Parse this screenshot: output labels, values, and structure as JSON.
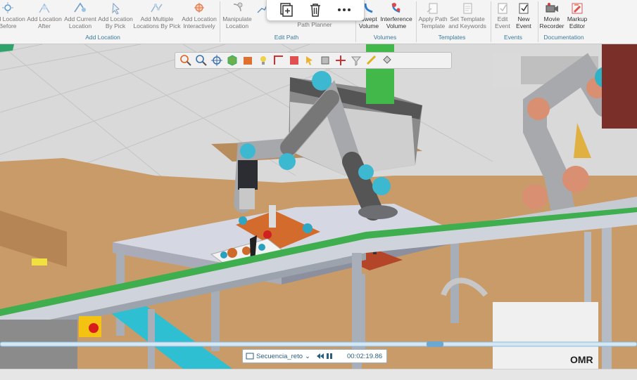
{
  "ribbon": {
    "buttons": [
      {
        "id": "add-location-before",
        "label": "Add Location\nBefore"
      },
      {
        "id": "add-location-after",
        "label": "Add Location\nAfter"
      },
      {
        "id": "add-current-location",
        "label": "Add Current\nLocation"
      },
      {
        "id": "add-location-by-pick",
        "label": "Add Location\nBy Pick"
      },
      {
        "id": "add-multiple-locations",
        "label": "Add Multiple\nLocations By Pick"
      },
      {
        "id": "add-location-interactively",
        "label": "Add Location\nInteractively"
      },
      {
        "id": "manipulate-location",
        "label": "Manipulate\nLocation"
      },
      {
        "id": "path-planner",
        "label": "Path Planner"
      },
      {
        "id": "swept-volume",
        "label": "Swept\nVolume"
      },
      {
        "id": "interference-volume",
        "label": "Interference\nVolume"
      },
      {
        "id": "apply-path-template",
        "label": "Apply Path\nTemplate"
      },
      {
        "id": "set-template-keywords",
        "label": "Set Template\nand Keywords"
      },
      {
        "id": "edit-event",
        "label": "Edit\nEvent"
      },
      {
        "id": "new-event",
        "label": "New\nEvent"
      },
      {
        "id": "movie-recorder",
        "label": "Movie\nRecorder"
      },
      {
        "id": "markup-editor",
        "label": "Markup\nEditor"
      }
    ],
    "groups": {
      "add_location": "Add Location",
      "edit_path": "Edit Path",
      "volumes": "Volumes",
      "templates": "Templates",
      "events": "Events",
      "documentation": "Documentation"
    }
  },
  "player": {
    "sequence": "Secuencia_reto",
    "time": "00:02:19.86"
  },
  "timeline": {
    "position": 0.683
  },
  "scene": {
    "brand_text": "OMR"
  }
}
